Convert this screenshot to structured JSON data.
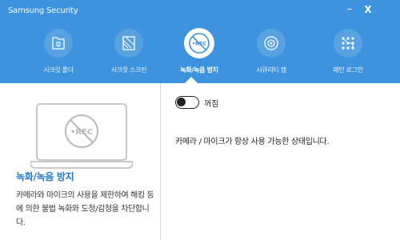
{
  "window": {
    "title": "Samsung Security",
    "minimize_glyph": "–",
    "close_glyph": "X"
  },
  "nav": {
    "items": [
      {
        "label": "시크릿 폴더",
        "icon": "secret-folder-icon",
        "active": false
      },
      {
        "label": "시크릿 스크린",
        "icon": "secret-screen-icon",
        "active": false
      },
      {
        "label": "녹화/녹음 방지",
        "icon": "rec-block-icon",
        "active": true
      },
      {
        "label": "시큐리티 캠",
        "icon": "security-cam-icon",
        "active": false
      },
      {
        "label": "패턴 로그인",
        "icon": "pattern-login-icon",
        "active": false
      }
    ]
  },
  "feature": {
    "title": "녹화/녹음 방지",
    "description": "카메라와 마이크의 사용을 제한하여 해킹 등에 의한 불법 녹화와 도청/감청을 차단합니다.",
    "illustration": "laptop-rec-icon",
    "rec_text": "•REC"
  },
  "settings": {
    "toggle_label": "꺼짐",
    "toggle_on": false,
    "status_text": "카메라 / 마이크가 항상 사용 가능한 상태입니다."
  },
  "colors": {
    "header_bg": "#3d93dd",
    "accent": "#1f77c8"
  }
}
